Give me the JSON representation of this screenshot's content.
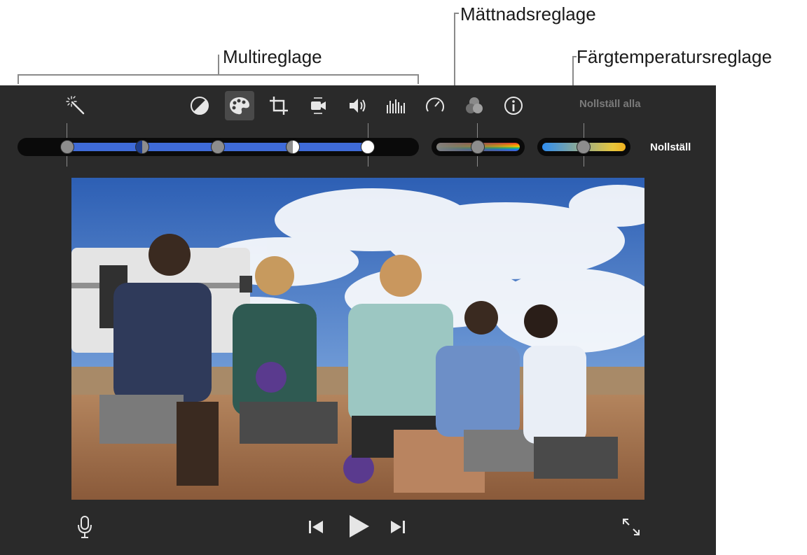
{
  "callouts": {
    "multi": "Multireglage",
    "saturation": "Mättnadsreglage",
    "temperature": "Färgtemperatursreglage"
  },
  "toolbar": {
    "icons": [
      "magic-wand-icon",
      "color-balance-icon",
      "color-correction-icon",
      "crop-icon",
      "stabilization-icon",
      "volume-icon",
      "equalizer-icon",
      "speed-icon",
      "noise-filter-icon",
      "info-icon"
    ],
    "active": "color-correction-icon",
    "reset_all_label": "Nollställ alla"
  },
  "sliders": {
    "multi_knob_levels": [
      0.0,
      0.25,
      0.5,
      0.75,
      1.0
    ],
    "saturation_level": 0.5,
    "temperature_level": 0.5,
    "reset_label": "Nollställ"
  },
  "colors": {
    "track_fill": "#3f6bd8",
    "accent_text": "#ffffff",
    "disabled_text": "#7a7a7a"
  },
  "playback": {
    "icons": [
      "microphone-icon",
      "skip-back-icon",
      "play-icon",
      "skip-forward-icon",
      "fullscreen-icon"
    ]
  }
}
